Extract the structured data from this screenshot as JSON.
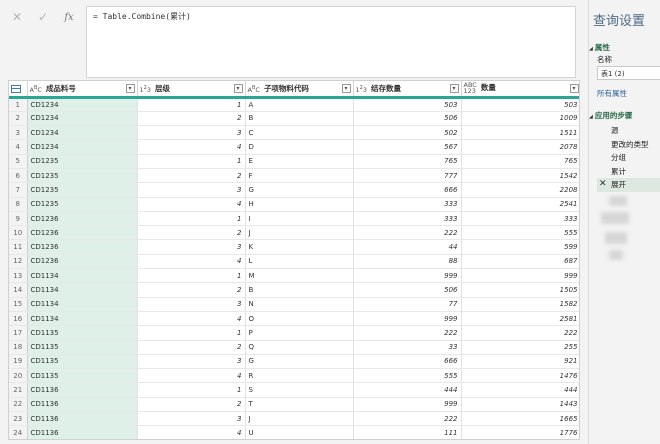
{
  "formula": {
    "cancel_icon": "✕",
    "confirm_icon": "✓",
    "fx_label": "fx",
    "text": "= Table.Combine(累计)"
  },
  "table": {
    "columns": [
      {
        "type": "ABC",
        "name": "成品料号"
      },
      {
        "type": "123",
        "name": "层级"
      },
      {
        "type": "ABC",
        "name": "子项物料代码"
      },
      {
        "type": "123",
        "name": "结存数量"
      },
      {
        "type": "ABC123",
        "name": "数量"
      }
    ],
    "rows": [
      [
        "1",
        "CD1234",
        "1",
        "A",
        "503",
        "503"
      ],
      [
        "2",
        "CD1234",
        "2",
        "B",
        "506",
        "1009"
      ],
      [
        "3",
        "CD1234",
        "3",
        "C",
        "502",
        "1511"
      ],
      [
        "4",
        "CD1234",
        "4",
        "D",
        "567",
        "2078"
      ],
      [
        "5",
        "CD1235",
        "1",
        "E",
        "765",
        "765"
      ],
      [
        "6",
        "CD1235",
        "2",
        "F",
        "777",
        "1542"
      ],
      [
        "7",
        "CD1235",
        "3",
        "G",
        "666",
        "2208"
      ],
      [
        "8",
        "CD1235",
        "4",
        "H",
        "333",
        "2541"
      ],
      [
        "9",
        "CD1236",
        "1",
        "I",
        "333",
        "333"
      ],
      [
        "10",
        "CD1236",
        "2",
        "J",
        "222",
        "555"
      ],
      [
        "11",
        "CD1236",
        "3",
        "K",
        "44",
        "599"
      ],
      [
        "12",
        "CD1236",
        "4",
        "L",
        "88",
        "687"
      ],
      [
        "13",
        "CD1134",
        "1",
        "M",
        "999",
        "999"
      ],
      [
        "14",
        "CD1134",
        "2",
        "B",
        "506",
        "1505"
      ],
      [
        "15",
        "CD1134",
        "3",
        "N",
        "77",
        "1582"
      ],
      [
        "16",
        "CD1134",
        "4",
        "O",
        "999",
        "2581"
      ],
      [
        "17",
        "CD1135",
        "1",
        "P",
        "222",
        "222"
      ],
      [
        "18",
        "CD1135",
        "2",
        "Q",
        "33",
        "255"
      ],
      [
        "19",
        "CD1135",
        "3",
        "G",
        "666",
        "921"
      ],
      [
        "20",
        "CD1135",
        "4",
        "R",
        "555",
        "1476"
      ],
      [
        "21",
        "CD1136",
        "1",
        "S",
        "444",
        "444"
      ],
      [
        "22",
        "CD1136",
        "2",
        "T",
        "999",
        "1443"
      ],
      [
        "23",
        "CD1136",
        "3",
        "J",
        "222",
        "1665"
      ],
      [
        "24",
        "CD1136",
        "4",
        "U",
        "111",
        "1776"
      ]
    ]
  },
  "panel": {
    "title": "查询设置",
    "properties_header": "属性",
    "name_label": "名称",
    "name_value": "表1 (2)",
    "all_properties_link": "所有属性",
    "applied_steps_header": "应用的步骤",
    "steps": [
      "源",
      "更改的类型",
      "分组",
      "累计",
      "展开"
    ],
    "active_step": "展开"
  },
  "colors": {
    "accent": "#2aa694",
    "selected_column": "#dff0e8",
    "panel_title": "#4e6b8a"
  }
}
